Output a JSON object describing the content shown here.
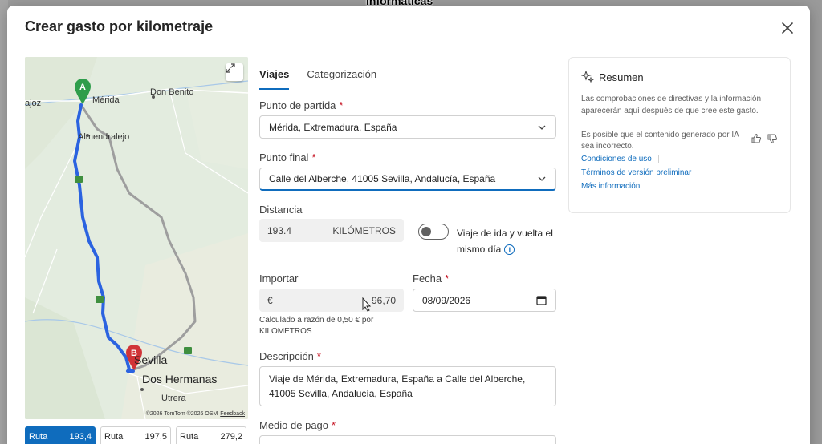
{
  "background": {
    "caption": "informáticas"
  },
  "dialog": {
    "title": "Crear gasto por kilometraje",
    "close_icon": "close-icon"
  },
  "map": {
    "labels": {
      "badajoz": "ajoz",
      "merida": "Mérida",
      "don_benito": "Don Benito",
      "almendralejo": "Almendralejo",
      "sevilla": "Sevilla",
      "dos_hermanas": "Dos Hermanas",
      "utrera": "Utrera"
    },
    "marker_start": "A",
    "marker_end": "B",
    "attribution": "©2026 TomTom ©2026 OSM",
    "feedback": "Feedback",
    "colors": {
      "route": "#2b63e0",
      "alt_route": "#9e9e9e",
      "marker": "#d13438",
      "marker_start": "#2e9d4b"
    }
  },
  "routes": [
    {
      "name": "Ruta",
      "value": "193,4",
      "active": true
    },
    {
      "name": "Ruta",
      "value": "197,5",
      "active": false
    },
    {
      "name": "Ruta",
      "value": "279,2",
      "active": false
    }
  ],
  "tabs": [
    {
      "label": "Viajes",
      "active": true
    },
    {
      "label": "Categorización",
      "active": false
    }
  ],
  "form": {
    "start": {
      "label": "Punto de partida",
      "required": "*",
      "value": "Mérida, Extremadura, España"
    },
    "end": {
      "label": "Punto final",
      "required": "*",
      "value": "Calle del Alberche, 41005 Sevilla, Andalucía, España"
    },
    "distance": {
      "label": "Distancia",
      "value": "193.4",
      "unit": "KILÓMETROS"
    },
    "roundtrip": {
      "label": "Viaje de ida y vuelta el mismo día",
      "on": false
    },
    "amount": {
      "label": "Importar",
      "currency": "€",
      "value": "96,70"
    },
    "date": {
      "label": "Fecha",
      "required": "*",
      "value": "08/09/2026"
    },
    "rate_hint": "Calculado a razón de 0,50 € por KILOMETROS",
    "description": {
      "label": "Descripción",
      "required": "*",
      "value": "Viaje de Mérida, Extremadura, España a Calle del Alberche, 41005 Sevilla, Andalucía, España"
    },
    "payment": {
      "label": "Medio de pago",
      "required": "*"
    }
  },
  "summary": {
    "title": "Resumen",
    "text": "Las comprobaciones de directivas y la información aparecerán aquí después de que cree este gasto.",
    "ai_notice": "Es posible que el contenido generado por IA sea incorrecto.",
    "links": [
      "Condiciones de uso",
      "Términos de versión preliminar",
      "Más información"
    ]
  },
  "accent": "#0f6cbd"
}
